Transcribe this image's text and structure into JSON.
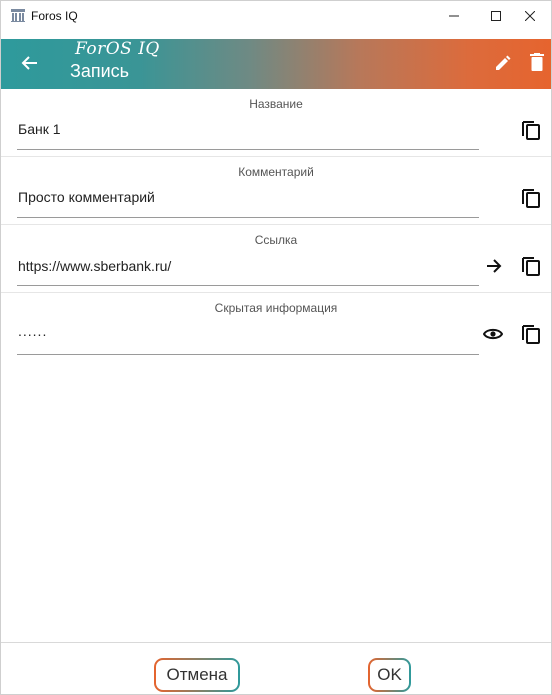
{
  "window": {
    "title": "Foros IQ"
  },
  "appbar": {
    "brand": "ForOS IQ",
    "title": "Запись"
  },
  "fields": [
    {
      "label": "Название",
      "value": "Банк 1"
    },
    {
      "label": "Комментарий",
      "value": "Просто комментарий"
    },
    {
      "label": "Ссылка",
      "value": "https://www.sberbank.ru/"
    },
    {
      "label": "Скрытая информация",
      "value": "......"
    }
  ],
  "buttons": {
    "cancel": "Отмена",
    "ok": "OK"
  },
  "colors": {
    "gradient_start": "#2e9a9c",
    "gradient_end": "#e6642e"
  }
}
